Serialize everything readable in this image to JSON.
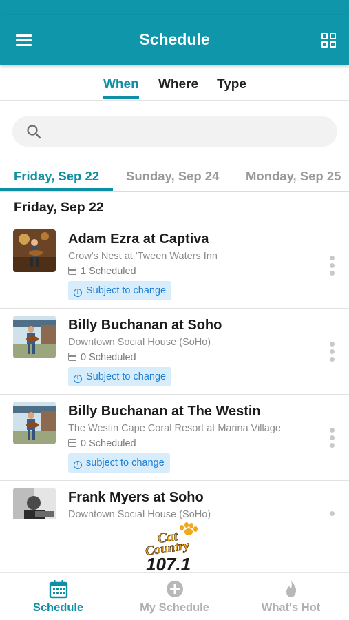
{
  "app": {
    "title": "Schedule",
    "accent": "#0f96ab",
    "menu_icon": "hamburger-menu-icon",
    "grid_icon": "grid-view-icon"
  },
  "filter_tabs": [
    {
      "label": "When",
      "active": true
    },
    {
      "label": "Where",
      "active": false
    },
    {
      "label": "Type",
      "active": false
    }
  ],
  "search": {
    "value": "",
    "placeholder": "",
    "icon": "search-icon"
  },
  "day_tabs": [
    {
      "label": "Friday, Sep 22",
      "active": true
    },
    {
      "label": "Sunday, Sep 24",
      "active": false
    },
    {
      "label": "Monday, Sep 25",
      "active": false
    }
  ],
  "section_title": "Friday, Sep 22",
  "sessions": [
    {
      "title": "Adam Ezra at Captiva",
      "location": "Crow's Nest at 'Tween Waters Inn",
      "scheduled": "1 Scheduled",
      "badge": "Subject to change"
    },
    {
      "title": "Billy Buchanan at Soho",
      "location": "Downtown Social House (SoHo)",
      "scheduled": "0 Scheduled",
      "badge": "Subject to change"
    },
    {
      "title": "Billy Buchanan at The Westin",
      "location": "The Westin Cape Coral Resort at Marina Village",
      "scheduled": "0 Scheduled",
      "badge": "subject to change"
    },
    {
      "title": "Frank Myers at Soho",
      "location": "Downtown Social House (SoHo)",
      "scheduled": "",
      "badge": ""
    }
  ],
  "sponsor_logo": {
    "line1": "Cat",
    "line2": "Country",
    "line3": "107.1"
  },
  "bottom_nav": [
    {
      "label": "Schedule",
      "icon": "calendar-icon",
      "active": true
    },
    {
      "label": "My Schedule",
      "icon": "plus-circle-icon",
      "active": false
    },
    {
      "label": "What's Hot",
      "icon": "flame-icon",
      "active": false
    }
  ],
  "colors": {
    "accent": "#0f8fa3",
    "badge_bg": "#d7edfc",
    "badge_text": "#1f7fd4"
  }
}
